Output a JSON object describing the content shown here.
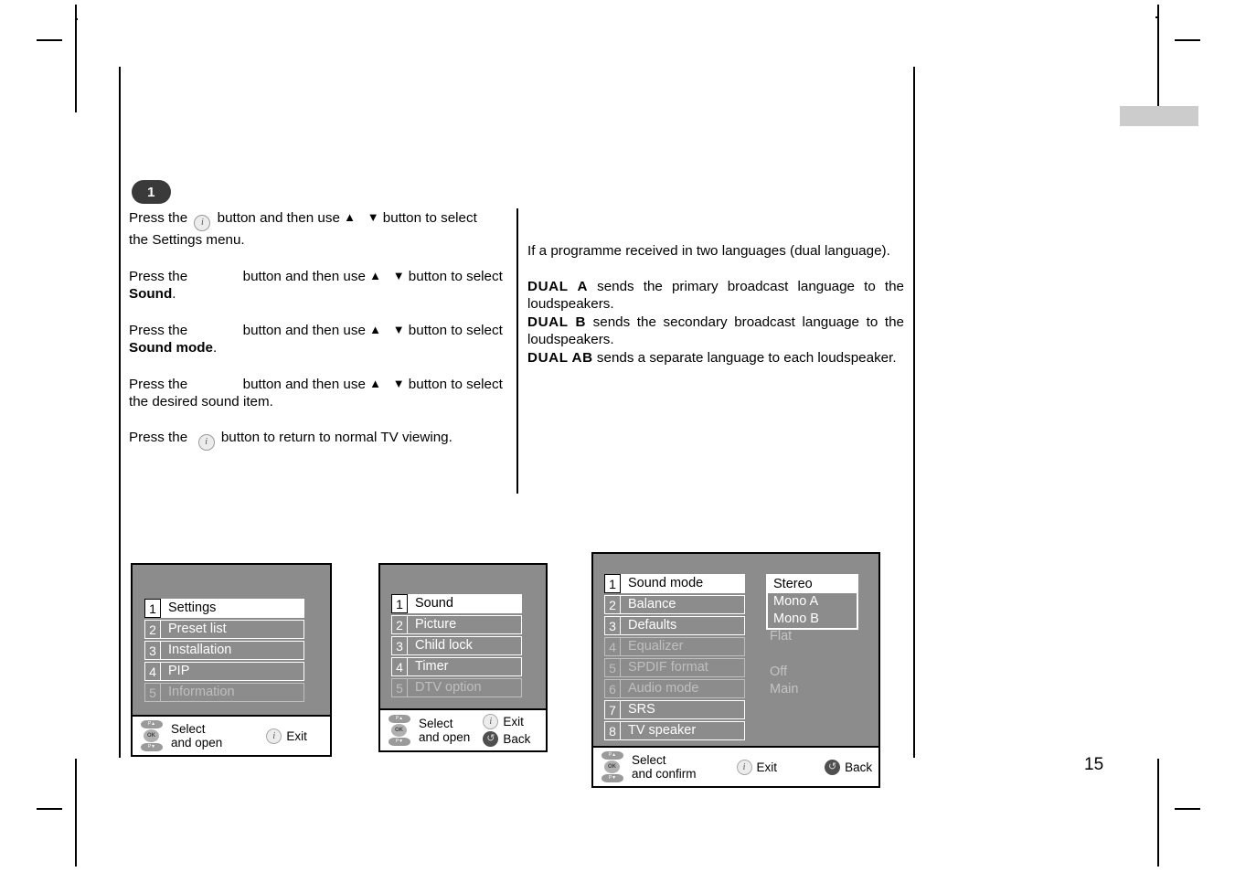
{
  "page": {
    "number": "15"
  },
  "step": {
    "badge": "1"
  },
  "instructions": {
    "lines": [
      {
        "pre": "Press the ",
        "icon": "i",
        "mid": " button and then use ",
        "up": "▲",
        "down": "▼",
        "post": " button to select",
        "second": "the Settings menu.",
        "bold": ""
      },
      {
        "pre": "Press the ",
        "icon": "gap",
        "mid": " button and then use ",
        "up": "▲",
        "down": "▼",
        "post": " button to select",
        "second": "",
        "bold": "Sound",
        "boldtail": "."
      },
      {
        "pre": "Press the ",
        "icon": "gap",
        "mid": " button and then use ",
        "up": "▲",
        "down": "▼",
        "post": " button to select",
        "second": "",
        "bold": "Sound mode",
        "boldtail": "."
      },
      {
        "pre": "Press the ",
        "icon": "gap",
        "mid": " button and then use ",
        "up": "▲",
        "down": "▼",
        "post": " button to select",
        "second": "the desired sound item.",
        "bold": ""
      },
      {
        "pre": "Press the ",
        "icon": "i",
        "mid": " button to return to normal TV viewing.",
        "up": "",
        "down": "",
        "post": "",
        "second": "",
        "bold": ""
      }
    ],
    "l1a": "Press the",
    "l1b": "button and then use",
    "l1c": "button to select",
    "l1d": "the Settings menu.",
    "l2b": "button and then use",
    "l2c": "button to select",
    "l2bold": "Sound",
    "l2dot": ".",
    "l3bold": "Sound mode",
    "l3dot": ".",
    "l4d": "the desired sound item.",
    "l5": "button to return to normal TV viewing."
  },
  "dual_info": {
    "intro": "If a programme received in two languages (dual language).",
    "items": [
      {
        "name": "DUAL A",
        "text": " sends the primary broadcast language to the loudspeakers."
      },
      {
        "name": "DUAL B",
        "text": " sends the secondary broadcast language to the loudspeakers."
      },
      {
        "name": "DUAL AB",
        "text": " sends a separate language to each loudspeaker."
      }
    ]
  },
  "osd_menus": [
    {
      "id": "settings-menu",
      "rows": [
        {
          "num": "1",
          "label": "Settings",
          "state": "selected"
        },
        {
          "num": "2",
          "label": "Preset list",
          "state": "normal"
        },
        {
          "num": "3",
          "label": "Installation",
          "state": "normal"
        },
        {
          "num": "4",
          "label": "PIP",
          "state": "normal"
        },
        {
          "num": "5",
          "label": "Information",
          "state": "dim"
        }
      ],
      "help": {
        "select_line1": "Select",
        "select_line2": "and open",
        "exit": "Exit",
        "back": null
      }
    },
    {
      "id": "sound-menu",
      "rows": [
        {
          "num": "1",
          "label": "Sound",
          "state": "selected"
        },
        {
          "num": "2",
          "label": "Picture",
          "state": "normal"
        },
        {
          "num": "3",
          "label": "Child lock",
          "state": "normal"
        },
        {
          "num": "4",
          "label": "Timer",
          "state": "normal"
        },
        {
          "num": "5",
          "label": "DTV option",
          "state": "dim"
        }
      ],
      "help": {
        "select_line1": "Select",
        "select_line2": "and open",
        "exit": "Exit",
        "back": "Back"
      }
    },
    {
      "id": "sound-mode-menu",
      "rows": [
        {
          "num": "1",
          "label": "Sound mode",
          "state": "selected",
          "value": ""
        },
        {
          "num": "2",
          "label": "Balance",
          "state": "normal",
          "value": ""
        },
        {
          "num": "3",
          "label": "Defaults",
          "state": "normal",
          "value": "Flat"
        },
        {
          "num": "4",
          "label": "Equalizer",
          "state": "dim",
          "value": ""
        },
        {
          "num": "5",
          "label": "SPDIF format",
          "state": "dim",
          "value": "Off"
        },
        {
          "num": "6",
          "label": "Audio mode",
          "state": "dim",
          "value": "Main"
        },
        {
          "num": "7",
          "label": "SRS",
          "state": "normal",
          "value": ""
        },
        {
          "num": "8",
          "label": "TV speaker",
          "state": "normal",
          "value": ""
        }
      ],
      "popup": {
        "options": [
          {
            "label": "Stereo",
            "state": "selected"
          },
          {
            "label": "Mono A",
            "state": "normal"
          },
          {
            "label": "Mono B",
            "state": "normal"
          }
        ]
      },
      "help": {
        "select_line1": "Select",
        "select_line2": "and confirm",
        "exit": "Exit",
        "back": "Back"
      }
    }
  ],
  "icons": {
    "info": "i",
    "back_arrow": "↺",
    "ok": "OK",
    "prog_up": "P▲",
    "prog_down": "P▼",
    "arrow_up": "▲",
    "arrow_down": "▼"
  },
  "colors": {
    "osd_background": "#8c8c8c",
    "osd_selected": "#ffffff",
    "osd_dim_text": "#bfbfbf",
    "badge": "#3a3a3a",
    "tab_marker": "#cccccc"
  }
}
